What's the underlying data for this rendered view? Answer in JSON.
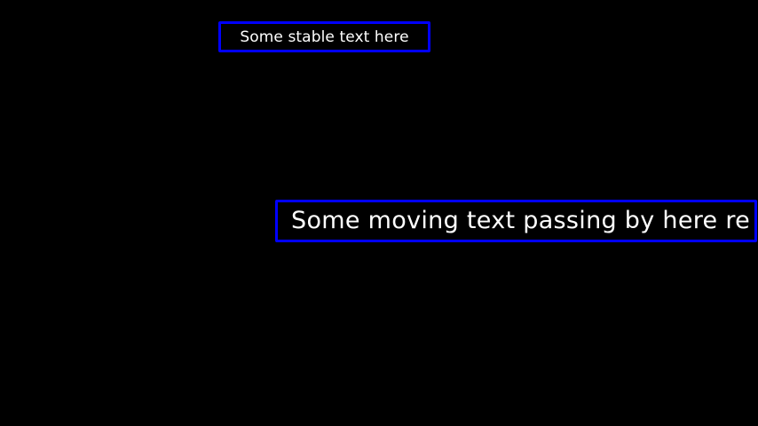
{
  "colors": {
    "background": "#000000",
    "box_border": "#0000ff",
    "text": "#ffffff"
  },
  "stable_caption": {
    "text": "Some stable text here"
  },
  "moving_caption": {
    "text": "Some moving text passing by here re"
  }
}
